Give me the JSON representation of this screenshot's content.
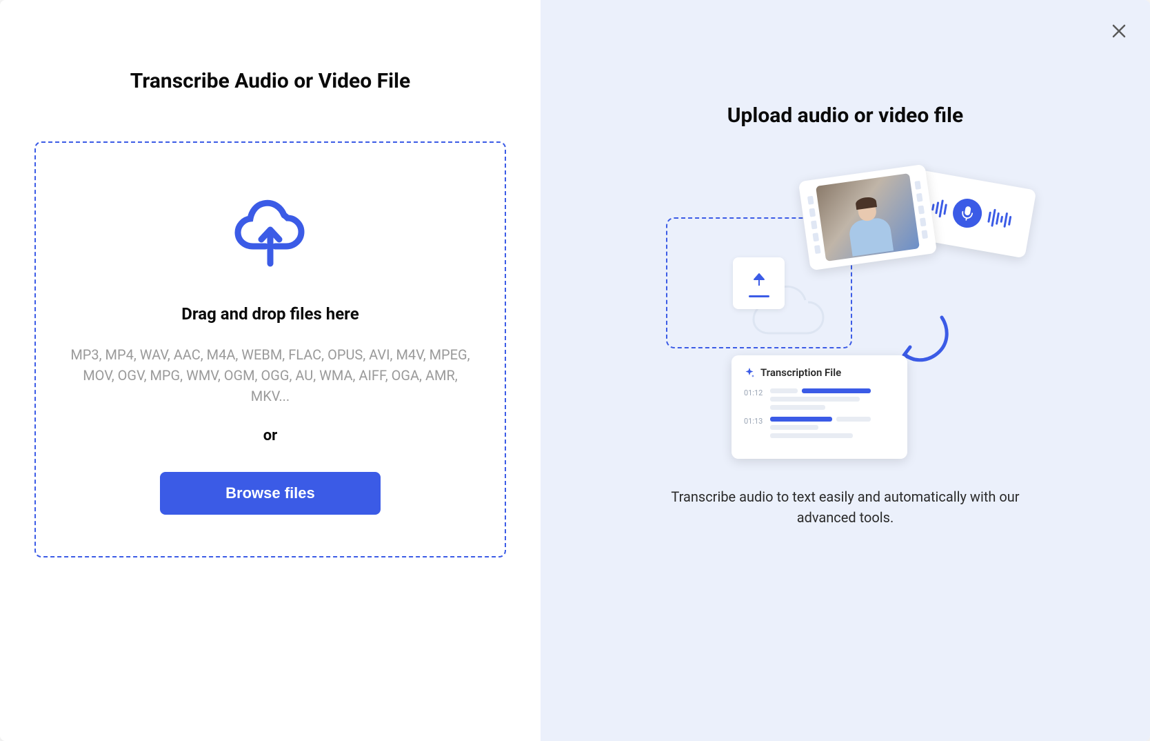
{
  "left": {
    "title": "Transcribe Audio or Video File",
    "drop_text": "Drag and drop files here",
    "formats": "MP3, MP4, WAV, AAC, M4A, WEBM, FLAC, OPUS, AVI, M4V, MPEG, MOV, OGV, MPG, WMV, OGM, OGG, AU, WMA, AIFF, OGA, AMR, MKV...",
    "or_text": "or",
    "browse_label": "Browse files"
  },
  "right": {
    "title": "Upload audio or video file",
    "transcript_title": "Transcription File",
    "timestamps": [
      "01:12",
      "01:13"
    ],
    "description": "Transcribe audio to text easily and automatically with our advanced tools."
  },
  "colors": {
    "primary": "#3b5be6",
    "panel_bg": "#ebf0fb"
  }
}
